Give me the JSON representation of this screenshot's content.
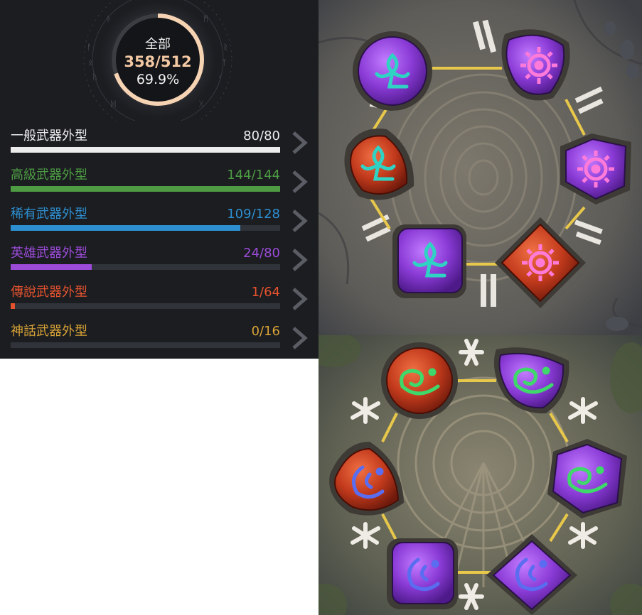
{
  "summary": {
    "label": "全部",
    "count": "358/512",
    "percent": "69.9%",
    "progress": 0.699
  },
  "categories": [
    {
      "name": "一般武器外型",
      "count": "80/80",
      "progress": 1.0,
      "color": "#ececec"
    },
    {
      "name": "高級武器外型",
      "count": "144/144",
      "progress": 1.0,
      "color": "#4e9b43"
    },
    {
      "name": "稀有武器外型",
      "count": "109/128",
      "progress": 0.852,
      "color": "#2d8fd0"
    },
    {
      "name": "英雄武器外型",
      "count": "24/80",
      "progress": 0.3,
      "color": "#9c4bd9"
    },
    {
      "name": "傳說武器外型",
      "count": "1/64",
      "progress": 0.016,
      "color": "#e5532e"
    },
    {
      "name": "神話武器外型",
      "count": "0/16",
      "progress": 0.0,
      "color": "#d9a336"
    }
  ],
  "puzzle_top": {
    "symbol_colors": {
      "leaf": "#2fd3c3",
      "sun": "#ff7ad9"
    },
    "gems": [
      {
        "material": "purple",
        "symbol": "leaf-icon"
      },
      {
        "material": "purple",
        "symbol": "sun-icon"
      },
      {
        "material": "purple",
        "symbol": "sun-icon"
      },
      {
        "material": "red",
        "symbol": "sun-icon"
      },
      {
        "material": "purple",
        "symbol": "leaf-icon"
      },
      {
        "material": "red",
        "symbol": "leaf-icon"
      }
    ]
  },
  "puzzle_bottom": {
    "symbol_colors": {
      "wave": "#3ed96a",
      "moon": "#5a6cf0"
    },
    "gems": [
      {
        "material": "red",
        "symbol": "wave-icon"
      },
      {
        "material": "purple",
        "symbol": "wave-icon"
      },
      {
        "material": "purple",
        "symbol": "wave-icon"
      },
      {
        "material": "purple",
        "symbol": "moon-icon"
      },
      {
        "material": "purple",
        "symbol": "moon-icon"
      },
      {
        "material": "red",
        "symbol": "moon-icon"
      }
    ]
  },
  "colors": {
    "panel_bg": "#1b1d21",
    "donut_fill": "#f6d3b3",
    "gem_purple": "#8a3bd6",
    "gem_red": "#c23a1c",
    "link_gold": "#e8c84a",
    "stone": "#6c6a62"
  }
}
